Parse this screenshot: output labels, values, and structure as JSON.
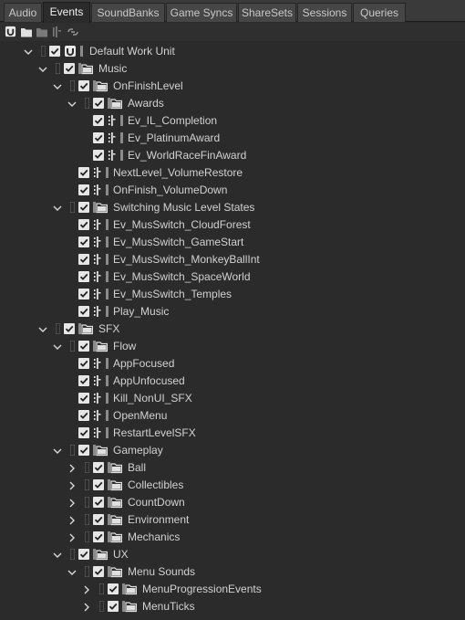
{
  "tabs": [
    {
      "label": "Audio",
      "active": false
    },
    {
      "label": "Events",
      "active": true
    },
    {
      "label": "SoundBanks",
      "active": false
    },
    {
      "label": "Game Syncs",
      "active": false
    },
    {
      "label": "ShareSets",
      "active": false
    },
    {
      "label": "Sessions",
      "active": false
    },
    {
      "label": "Queries",
      "active": false
    }
  ],
  "toolbar": {
    "icons": [
      "work-unit-icon",
      "folder-icon",
      "virtual-folder-icon",
      "event-icon",
      "link-icon"
    ]
  },
  "colors": {
    "background": "#2b2b2b",
    "checkbox": "#e6e6e6",
    "text": "#d2d2d2"
  },
  "tree": [
    {
      "label": "Default Work Unit",
      "depth": 0,
      "type": "workunit",
      "expanded": true
    },
    {
      "label": "Music",
      "depth": 1,
      "type": "workunit-folder",
      "expanded": true
    },
    {
      "label": "OnFinishLevel",
      "depth": 2,
      "type": "workunit-folder",
      "expanded": true
    },
    {
      "label": "Awards",
      "depth": 3,
      "type": "folder",
      "expanded": true
    },
    {
      "label": "Ev_IL_Completion",
      "depth": 4,
      "type": "event"
    },
    {
      "label": "Ev_PlatinumAward",
      "depth": 4,
      "type": "event"
    },
    {
      "label": "Ev_WorldRaceFinAward",
      "depth": 4,
      "type": "event"
    },
    {
      "label": "NextLevel_VolumeRestore",
      "depth": 3,
      "type": "event"
    },
    {
      "label": "OnFinish_VolumeDown",
      "depth": 3,
      "type": "event"
    },
    {
      "label": "Switching Music Level States",
      "depth": 2,
      "type": "workunit-folder",
      "expanded": true
    },
    {
      "label": "Ev_MusSwitch_CloudForest",
      "depth": 3,
      "type": "event"
    },
    {
      "label": "Ev_MusSwitch_GameStart",
      "depth": 3,
      "type": "event"
    },
    {
      "label": "Ev_MusSwitch_MonkeyBallInt",
      "depth": 3,
      "type": "event"
    },
    {
      "label": "Ev_MusSwitch_SpaceWorld",
      "depth": 3,
      "type": "event"
    },
    {
      "label": "Ev_MusSwitch_Temples",
      "depth": 3,
      "type": "event"
    },
    {
      "label": "Play_Music",
      "depth": 3,
      "type": "event"
    },
    {
      "label": "SFX",
      "depth": 1,
      "type": "workunit-folder",
      "expanded": true
    },
    {
      "label": "Flow",
      "depth": 2,
      "type": "workunit-folder",
      "expanded": true
    },
    {
      "label": "AppFocused",
      "depth": 3,
      "type": "event"
    },
    {
      "label": "AppUnfocused",
      "depth": 3,
      "type": "event"
    },
    {
      "label": "Kill_NonUI_SFX",
      "depth": 3,
      "type": "event"
    },
    {
      "label": "OpenMenu",
      "depth": 3,
      "type": "event"
    },
    {
      "label": "RestartLevelSFX",
      "depth": 3,
      "type": "event"
    },
    {
      "label": "Gameplay",
      "depth": 2,
      "type": "workunit-folder",
      "expanded": true
    },
    {
      "label": "Ball",
      "depth": 3,
      "type": "workunit-folder",
      "expanded": false
    },
    {
      "label": "Collectibles",
      "depth": 3,
      "type": "workunit-folder",
      "expanded": false
    },
    {
      "label": "CountDown",
      "depth": 3,
      "type": "workunit-folder",
      "expanded": false
    },
    {
      "label": "Environment",
      "depth": 3,
      "type": "workunit-folder",
      "expanded": false
    },
    {
      "label": "Mechanics",
      "depth": 3,
      "type": "workunit-folder",
      "expanded": false
    },
    {
      "label": "UX",
      "depth": 2,
      "type": "workunit-folder",
      "expanded": true
    },
    {
      "label": "Menu Sounds",
      "depth": 3,
      "type": "workunit-folder",
      "expanded": true
    },
    {
      "label": "MenuProgressionEvents",
      "depth": 4,
      "type": "workunit-folder",
      "expanded": false
    },
    {
      "label": "MenuTicks",
      "depth": 4,
      "type": "workunit-folder",
      "expanded": false
    }
  ]
}
